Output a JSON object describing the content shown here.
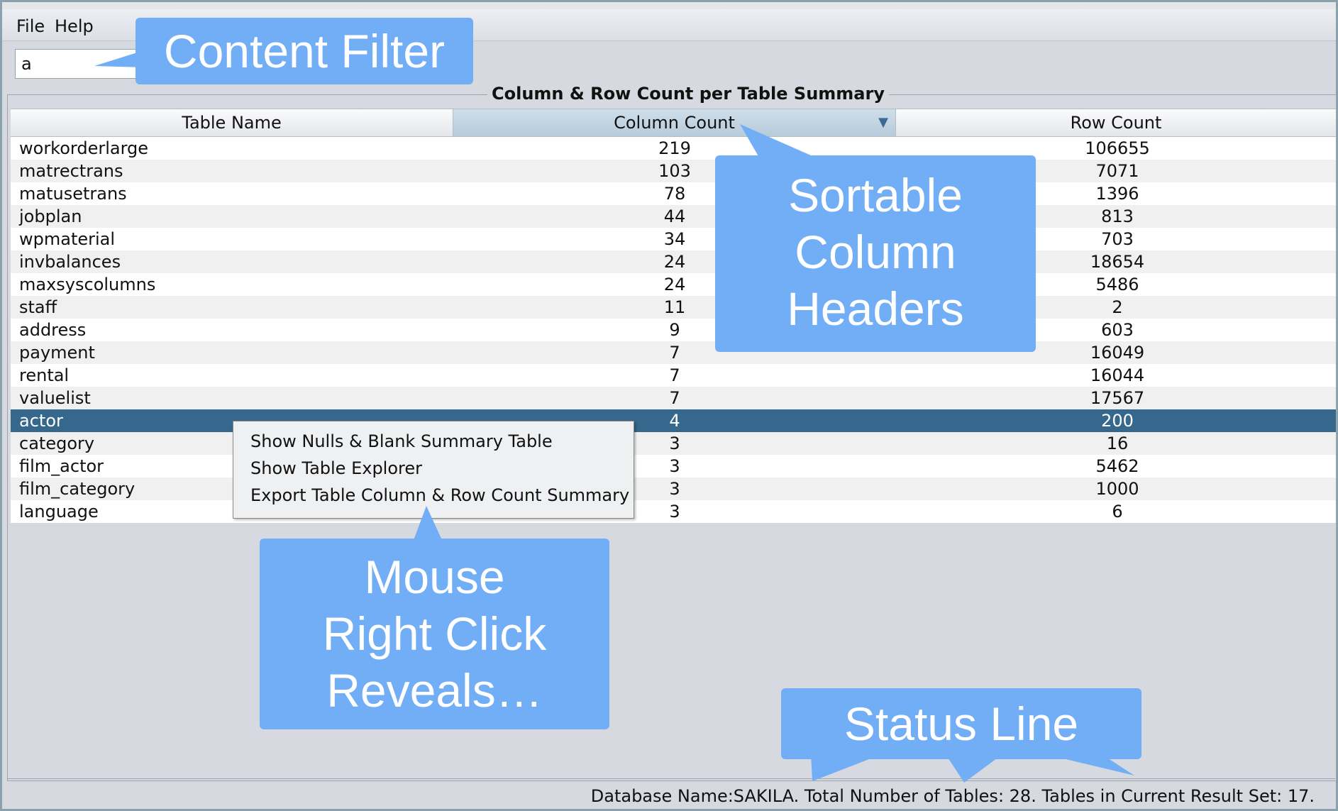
{
  "menu": {
    "file": "File",
    "help": "Help"
  },
  "filter": {
    "value": "a"
  },
  "panel_title": "Column & Row Count per Table Summary",
  "table": {
    "headers": [
      "Table Name",
      "Column Count",
      "Row Count"
    ],
    "sort_indicator": "▼",
    "rows": [
      {
        "name": "workorderlarge",
        "columns": "219",
        "rows": "106655"
      },
      {
        "name": "matrectrans",
        "columns": "103",
        "rows": "7071"
      },
      {
        "name": "matusetrans",
        "columns": "78",
        "rows": "1396"
      },
      {
        "name": "jobplan",
        "columns": "44",
        "rows": "813"
      },
      {
        "name": "wpmaterial",
        "columns": "34",
        "rows": "703"
      },
      {
        "name": "invbalances",
        "columns": "24",
        "rows": "18654"
      },
      {
        "name": "maxsyscolumns",
        "columns": "24",
        "rows": "5486"
      },
      {
        "name": "staff",
        "columns": "11",
        "rows": "2"
      },
      {
        "name": "address",
        "columns": "9",
        "rows": "603"
      },
      {
        "name": "payment",
        "columns": "7",
        "rows": "16049"
      },
      {
        "name": "rental",
        "columns": "7",
        "rows": "16044"
      },
      {
        "name": "valuelist",
        "columns": "7",
        "rows": "17567"
      },
      {
        "name": "actor",
        "columns": "4",
        "rows": "200"
      },
      {
        "name": "category",
        "columns": "3",
        "rows": "16"
      },
      {
        "name": "film_actor",
        "columns": "3",
        "rows": "5462"
      },
      {
        "name": "film_category",
        "columns": "3",
        "rows": "1000"
      },
      {
        "name": "language",
        "columns": "3",
        "rows": "6"
      }
    ],
    "selected_index": 12
  },
  "context_menu": {
    "items": [
      "Show Nulls & Blank Summary Table",
      "Show Table Explorer",
      "Export Table Column & Row Count Summary"
    ]
  },
  "callouts": {
    "content_filter": "Content Filter",
    "sortable_headers": [
      "Sortable",
      "Column",
      "Headers"
    ],
    "right_click": [
      "Mouse",
      "Right Click",
      "Reveals…"
    ],
    "status_line": "Status Line"
  },
  "status": "Database Name:SAKILA.  Total Number of Tables: 28. Tables in Current Result Set: 17.",
  "colors": {
    "callout": "#72aef5",
    "selection": "#36678c",
    "sorted_header": "#c3d5e3"
  }
}
